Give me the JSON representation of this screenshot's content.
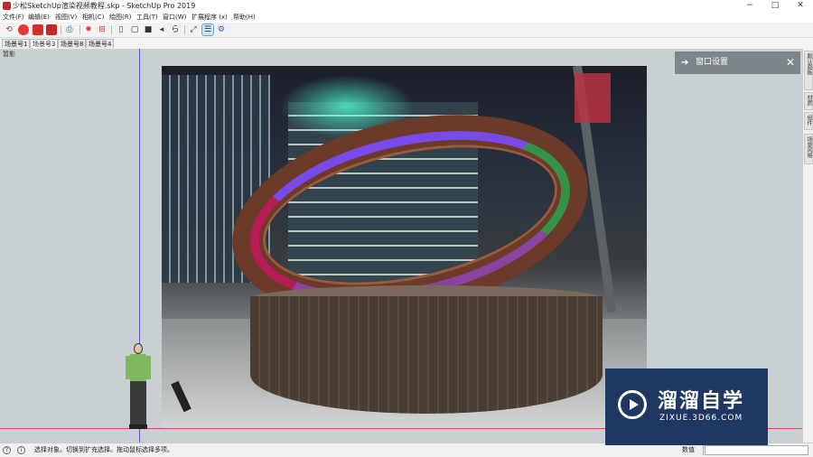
{
  "window": {
    "title": "少松SketchUp渲染视频教程.skp - SketchUp Pro 2019",
    "minimize": "−",
    "maximize": "□",
    "close": "✕"
  },
  "menu": {
    "items": [
      "文件(F)",
      "编辑(E)",
      "视图(V)",
      "相机(C)",
      "绘图(R)",
      "工具(T)",
      "窗口(W)",
      "扩展程序 (x)",
      "帮助(H)"
    ]
  },
  "toolbar": {
    "icons": [
      "walk-icon",
      "gear-icon",
      "folder-icon",
      "camera-icon",
      "print-icon",
      "sun-icon",
      "component-icon",
      "front-view-icon",
      "back-view-icon",
      "box-icon",
      "section-icon",
      "text-icon",
      "dimension-icon",
      "outliner-icon",
      "settings-icon"
    ],
    "accent": "#c62828",
    "selected_highlight": "#cfe3f7"
  },
  "scenes": {
    "tabs": [
      "场景号1",
      "场景号3",
      "场景号8",
      "场景号4"
    ],
    "active_index": 1
  },
  "viewport": {
    "label": "暂影",
    "background": "#c8d0d4",
    "axis_green_blue": "#5b5bd6",
    "axis_red": "#d64c4c"
  },
  "panel": {
    "title": "窗口设置",
    "arrow": "➔",
    "close": "✕"
  },
  "tray": {
    "tabs": [
      "默认面板",
      "材质",
      "组件",
      "场景风格"
    ]
  },
  "status": {
    "text": "选择对象。切换到扩充选择。拖动鼠标选择多项。",
    "measure_label": "数值",
    "measure_value": ""
  },
  "watermark": {
    "title": "溜溜自学",
    "subtitle": "ZIXUE.3D66.COM"
  }
}
